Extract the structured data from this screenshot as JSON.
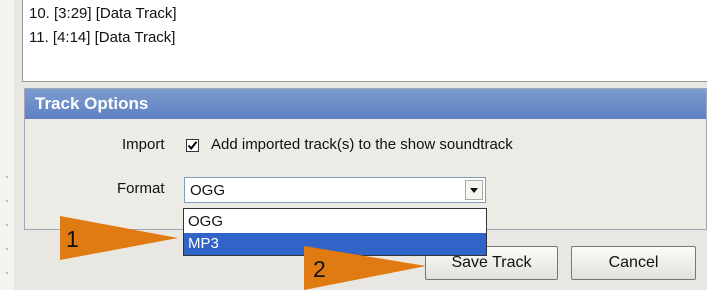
{
  "track_list": {
    "items": [
      "10. [3:29] [Data Track]",
      "11. [4:14] [Data Track]"
    ]
  },
  "track_options": {
    "header": "Track Options",
    "import_label": "Import",
    "import_checked": true,
    "import_checkbox_text": "Add imported track(s) to the show soundtrack",
    "format_label": "Format",
    "format_value": "OGG",
    "format_options": [
      "OGG",
      "MP3"
    ],
    "highlighted_option": "MP3"
  },
  "buttons": {
    "save": "Save Track",
    "cancel": "Cancel"
  },
  "annotations": {
    "callout_1": "1",
    "callout_2": "2",
    "arrow_color": "#e07a12"
  },
  "colors": {
    "header_bg": "#6a8cc8",
    "selection_bg": "#3064c8"
  }
}
